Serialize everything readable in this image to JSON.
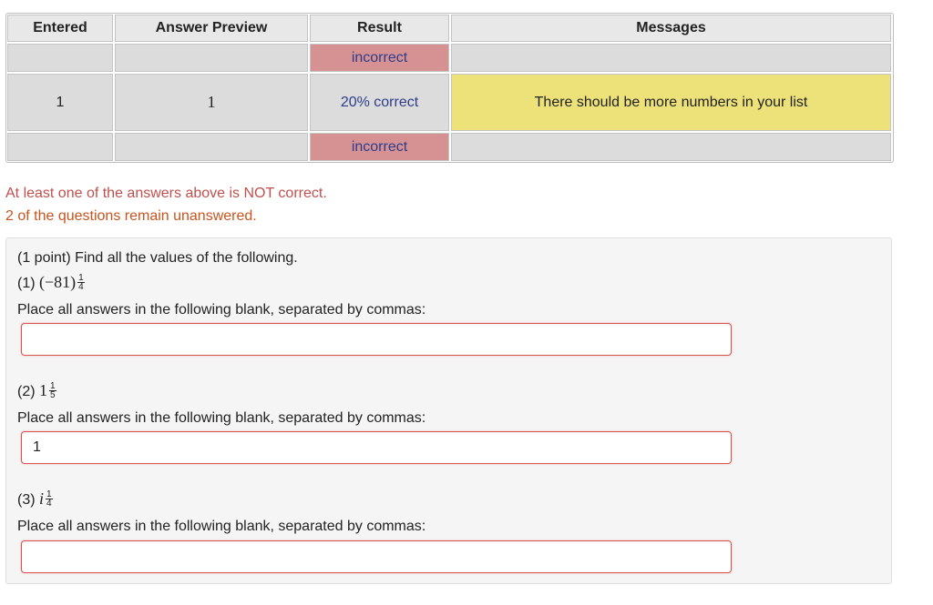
{
  "table": {
    "headers": [
      "Entered",
      "Answer Preview",
      "Result",
      "Messages"
    ],
    "rows": [
      {
        "entered": "",
        "preview": "",
        "result": "incorrect",
        "message": ""
      },
      {
        "entered": "1",
        "preview": "1",
        "result": "20% correct",
        "message": "There should be more numbers in your list"
      },
      {
        "entered": "",
        "preview": "",
        "result": "incorrect",
        "message": ""
      }
    ]
  },
  "status": {
    "line1": "At least one of the answers above is NOT correct.",
    "line2": "2 of the questions remain unanswered."
  },
  "problem": {
    "intro": "(1 point) Find all the values of the following.",
    "parts": [
      {
        "label": "(1)",
        "base": "(−81)",
        "exp_num": "1",
        "exp_den": "4",
        "instruction": "Place all answers in the following blank, separated by commas:",
        "value": ""
      },
      {
        "label": "(2)",
        "base": "1",
        "exp_num": "1",
        "exp_den": "5",
        "instruction": "Place all answers in the following blank, separated by commas:",
        "value": "1"
      },
      {
        "label": "(3)",
        "base": "i",
        "exp_num": "1",
        "exp_den": "4",
        "instruction": "Place all answers in the following blank, separated by commas:",
        "value": ""
      }
    ]
  },
  "colors": {
    "incorrect_bg": "#d69292",
    "message_bg": "#ede17a",
    "status_red": "#c0504d",
    "status_orange": "#c8541f",
    "result_text": "#2d3c8c"
  }
}
